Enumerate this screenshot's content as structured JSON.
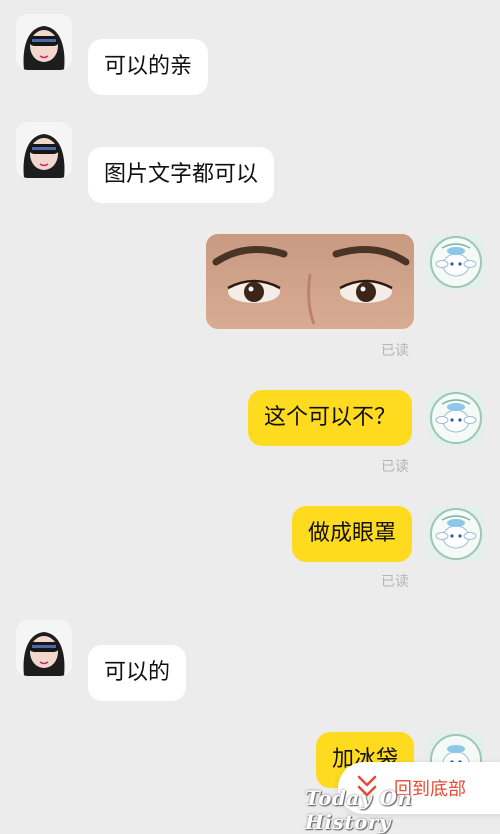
{
  "messages": [
    {
      "side": "left",
      "text": "可以的亲"
    },
    {
      "side": "left",
      "text": "图片文字都可以"
    },
    {
      "side": "right",
      "type": "image",
      "image_desc": "eyes-photo",
      "status": "已读"
    },
    {
      "side": "right",
      "text": "这个可以不？",
      "status": "已读"
    },
    {
      "side": "right",
      "text": "做成眼罩",
      "status": "已读"
    },
    {
      "side": "left",
      "text": "可以的"
    },
    {
      "side": "right",
      "text": "加冰袋"
    }
  ],
  "back_to_bottom": {
    "label": "回到底部",
    "icon": "double-chevron-down-icon"
  },
  "watermark": "Today On History",
  "colors": {
    "background": "#ececec",
    "left_bubble": "#ffffff",
    "right_bubble": "#ffdb1f",
    "accent": "#e94a33"
  }
}
